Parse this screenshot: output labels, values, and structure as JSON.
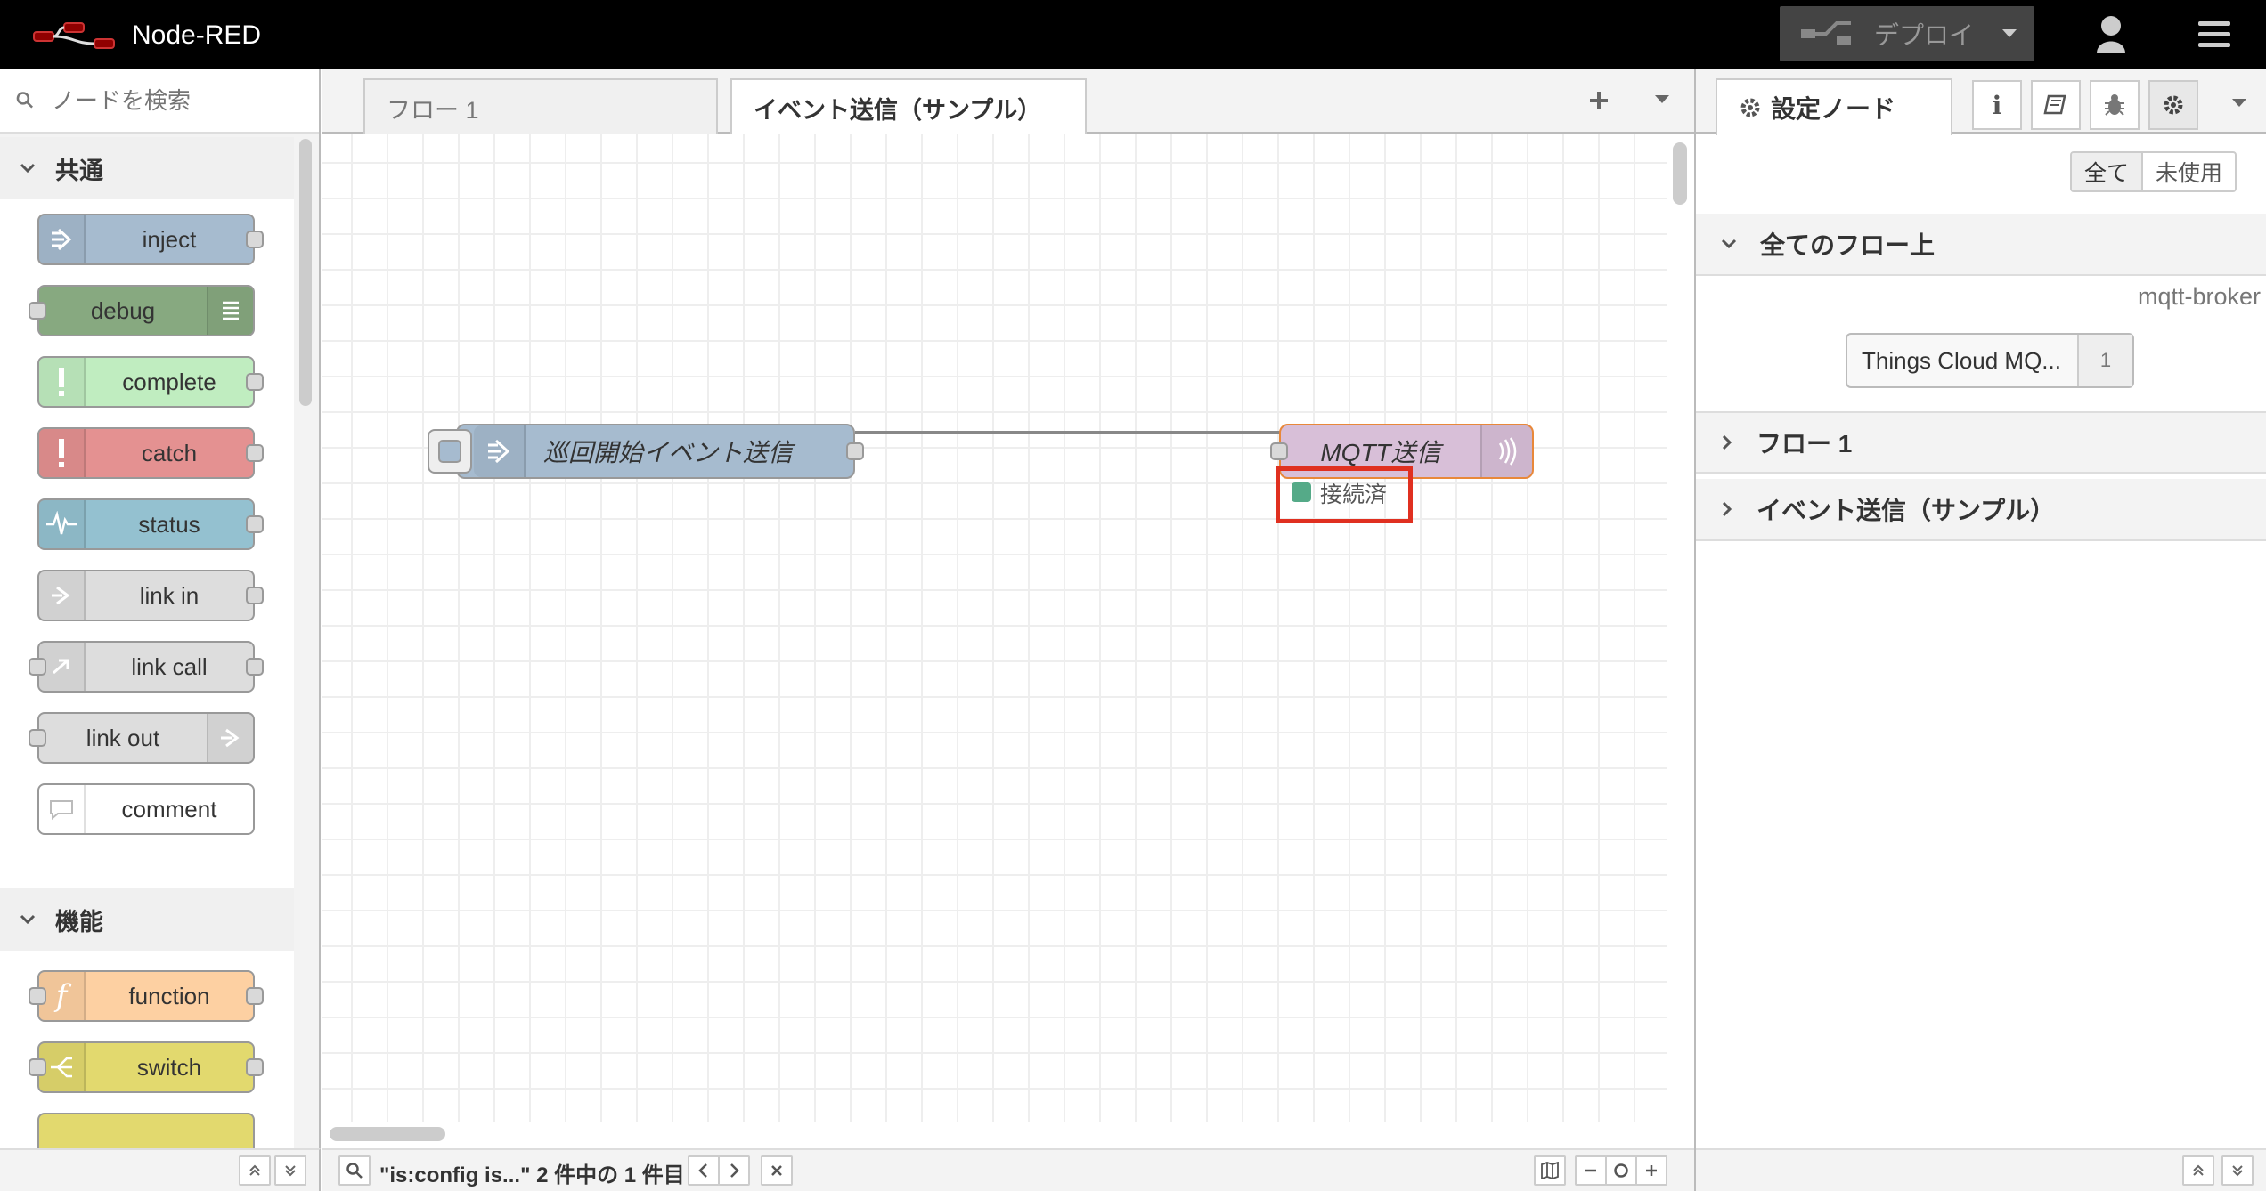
{
  "header": {
    "title": "Node-RED",
    "deploy_label": "デプロイ",
    "logo_icon": "node-red-logo-icon",
    "user_icon": "user-icon",
    "menu_icon": "hamburger-menu-icon"
  },
  "palette": {
    "search_placeholder": "ノードを検索",
    "categories": [
      {
        "label": "共通",
        "nodes": [
          {
            "label": "inject",
            "color": "#a6bbcf"
          },
          {
            "label": "debug",
            "color": "#87a980"
          },
          {
            "label": "complete",
            "color": "#c0edc0"
          },
          {
            "label": "catch",
            "color": "#e49191"
          },
          {
            "label": "status",
            "color": "#94c1d0"
          },
          {
            "label": "link in",
            "color": "#dddddd"
          },
          {
            "label": "link call",
            "color": "#dddddd"
          },
          {
            "label": "link out",
            "color": "#dddddd"
          },
          {
            "label": "comment",
            "color": "#ffffff"
          }
        ]
      },
      {
        "label": "機能",
        "nodes": [
          {
            "label": "function",
            "color": "#fdd0a2"
          },
          {
            "label": "switch",
            "color": "#e2d96e"
          }
        ]
      }
    ]
  },
  "workspace": {
    "tabs": [
      {
        "label": "フロー 1",
        "active": false
      },
      {
        "label": "イベント送信（サンプル）",
        "active": true
      }
    ],
    "nodes": {
      "inject_label": "巡回開始イベント送信",
      "mqtt_label": "MQTT送信",
      "mqtt_status": "接続済",
      "inject_color": "#a6bbcf",
      "mqtt_color": "#d8bfd8",
      "status_color": "#5a8"
    },
    "search_result": "\"is:config is...\" 2 件中の 1 件目"
  },
  "sidebar": {
    "active_tab_label": "設定ノード",
    "filter": {
      "all": "全て",
      "unused": "未使用"
    },
    "sections": [
      {
        "label": "全てのフロー上",
        "expanded": true
      },
      {
        "label": "フロー 1",
        "expanded": false
      },
      {
        "label": "イベント送信（サンプル）",
        "expanded": false
      }
    ],
    "config_type": "mqtt-broker",
    "config_node_label": "Things Cloud MQ...",
    "config_node_count": "1"
  }
}
